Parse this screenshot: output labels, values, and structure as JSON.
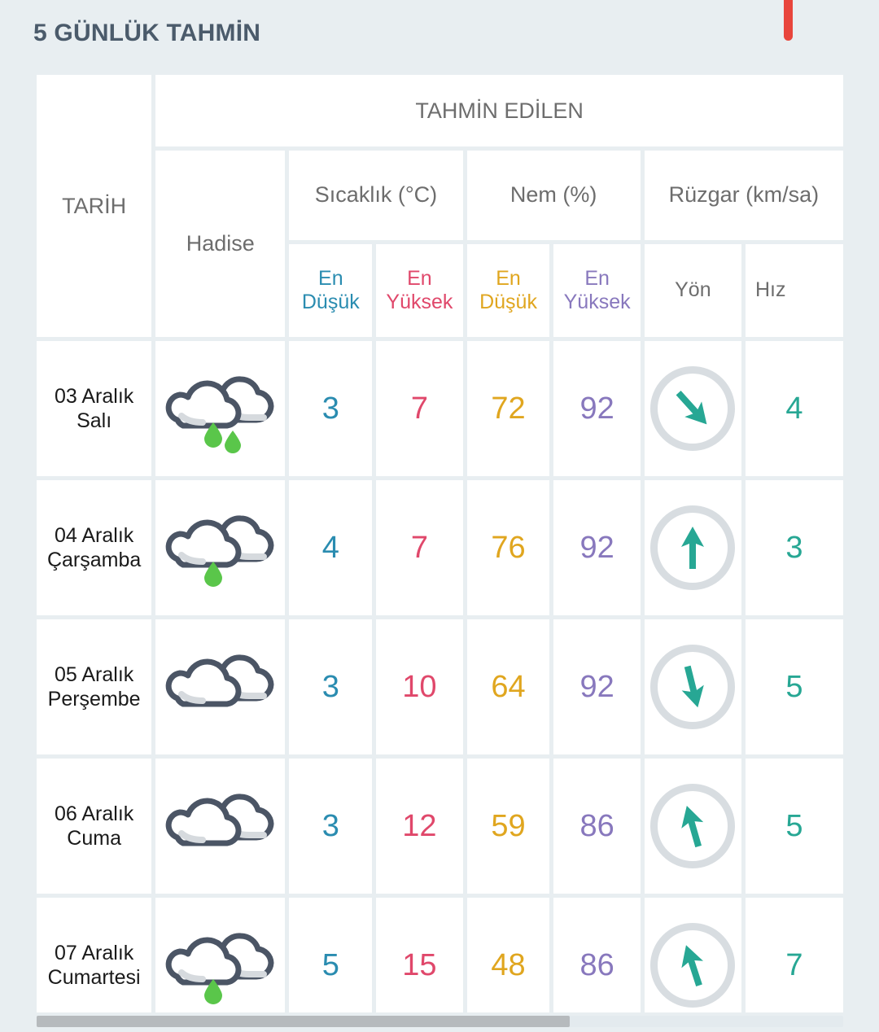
{
  "page": {
    "title": "5 GÜNLÜK TAHMİN",
    "accent_red": "#e8453c",
    "title_color": "#4b5b6b",
    "background": "#e8eef1"
  },
  "table": {
    "headers": {
      "tarih": "TARİH",
      "tahmin_edilen": "TAHMİN EDİLEN",
      "hadise": "Hadise",
      "sicaklik": "Sıcaklık (°C)",
      "nem": "Nem (%)",
      "ruzgar": "Rüzgar (km/sa)",
      "temp_min": "En Düşük",
      "temp_max": "En Yüksek",
      "hum_min": "En Düşük",
      "hum_max": "En Yüksek",
      "yon": "Yön",
      "hiz": "Hız"
    },
    "header_colors": {
      "temp_min": "#2a8cb0",
      "temp_max": "#e0486b",
      "hum_min": "#e0a61f",
      "hum_max": "#8878bd",
      "wind_speed": "#27a794",
      "neutral": "#6d6d6d"
    }
  },
  "chart_data": {
    "type": "table",
    "title": "5 GÜNLÜK TAHMİN",
    "columns": [
      "TARİH",
      "Hadise",
      "Sıcaklık En Düşük (°C)",
      "Sıcaklık En Yüksek (°C)",
      "Nem En Düşük (%)",
      "Nem En Yüksek (%)",
      "Rüzgar Yön",
      "Rüzgar Hız (km/sa)"
    ],
    "rows": [
      {
        "date_day": "03 Aralık",
        "date_weekday": "Salı",
        "condition_icon": "cloudy-rain-icon",
        "raindrops": 2,
        "temp_min": "3",
        "temp_max": "7",
        "hum_min": "72",
        "hum_max": "92",
        "wind_dir_deg": 138,
        "wind_dir_icon": "arrow-down-right-icon",
        "wind_speed": "4"
      },
      {
        "date_day": "04 Aralık",
        "date_weekday": "Çarşamba",
        "condition_icon": "cloudy-rain-icon",
        "raindrops": 1,
        "temp_min": "4",
        "temp_max": "7",
        "hum_min": "76",
        "hum_max": "92",
        "wind_dir_deg": 0,
        "wind_dir_icon": "arrow-up-icon",
        "wind_speed": "3"
      },
      {
        "date_day": "05 Aralık",
        "date_weekday": "Perşembe",
        "condition_icon": "cloudy-icon",
        "raindrops": 0,
        "temp_min": "3",
        "temp_max": "10",
        "hum_min": "64",
        "hum_max": "92",
        "wind_dir_deg": 166,
        "wind_dir_icon": "arrow-down-icon",
        "wind_speed": "5"
      },
      {
        "date_day": "06 Aralık",
        "date_weekday": "Cuma",
        "condition_icon": "cloudy-icon",
        "raindrops": 0,
        "temp_min": "3",
        "temp_max": "12",
        "hum_min": "59",
        "hum_max": "86",
        "wind_dir_deg": -16,
        "wind_dir_icon": "arrow-up-left-icon",
        "wind_speed": "5"
      },
      {
        "date_day": "07 Aralık",
        "date_weekday": "Cumartesi",
        "condition_icon": "cloudy-rain-icon",
        "raindrops": 1,
        "temp_min": "5",
        "temp_max": "15",
        "hum_min": "48",
        "hum_max": "86",
        "wind_dir_deg": -18,
        "wind_dir_icon": "arrow-up-left-icon",
        "wind_speed": "7"
      }
    ]
  }
}
